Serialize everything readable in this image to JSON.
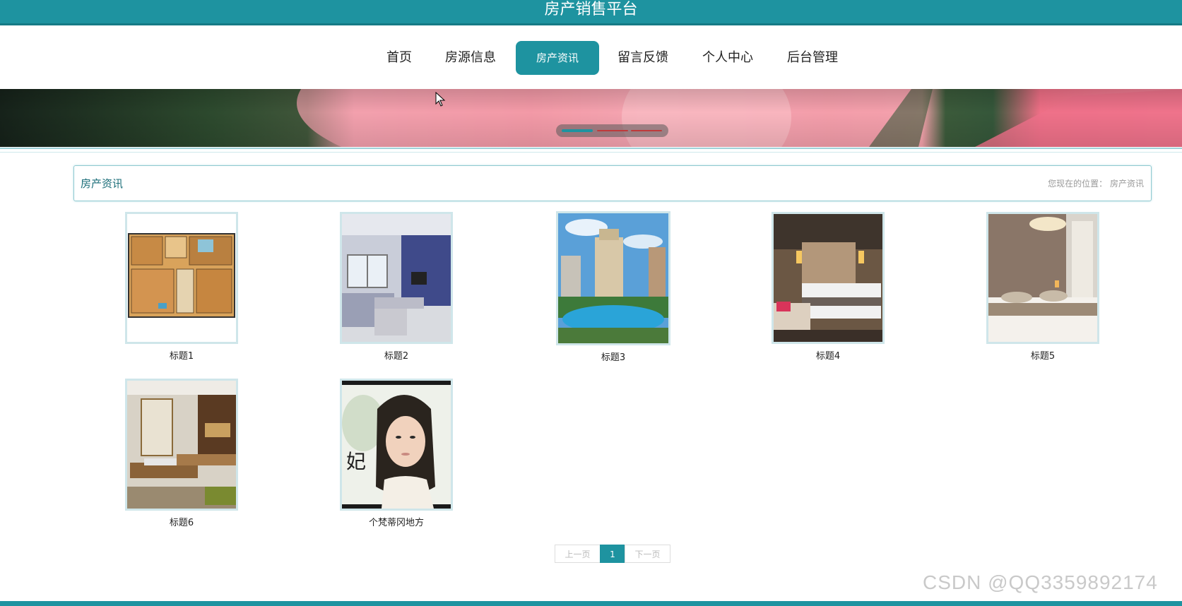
{
  "header": {
    "title": "房产销售平台"
  },
  "nav": {
    "items": [
      {
        "label": "首页"
      },
      {
        "label": "房源信息"
      },
      {
        "label": "房产资讯"
      },
      {
        "label": "留言反馈"
      },
      {
        "label": "个人中心"
      },
      {
        "label": "后台管理"
      }
    ],
    "active_index": 2
  },
  "carousel": {
    "slides": 3,
    "active_slide": 1
  },
  "section": {
    "title": "房产资讯",
    "breadcrumb_prefix": "您现在的位置：",
    "breadcrumb_current": "房产资讯"
  },
  "articles": [
    {
      "caption": "标题1",
      "image": "floor-plan"
    },
    {
      "caption": "标题2",
      "image": "living-room"
    },
    {
      "caption": "标题3",
      "image": "apartment-towers-pool"
    },
    {
      "caption": "标题4",
      "image": "hotel-bedroom"
    },
    {
      "caption": "标题5",
      "image": "modern-bedroom"
    },
    {
      "caption": "标题6",
      "image": "dining-room"
    },
    {
      "caption": "个梵蒂冈地方",
      "image": "portrait"
    }
  ],
  "pagination": {
    "prev": "上一页",
    "current": "1",
    "next": "下一页"
  },
  "watermark": "CSDN @QQ3359892174",
  "colors": {
    "primary": "#1e93a0",
    "border": "#8fc9d0"
  }
}
